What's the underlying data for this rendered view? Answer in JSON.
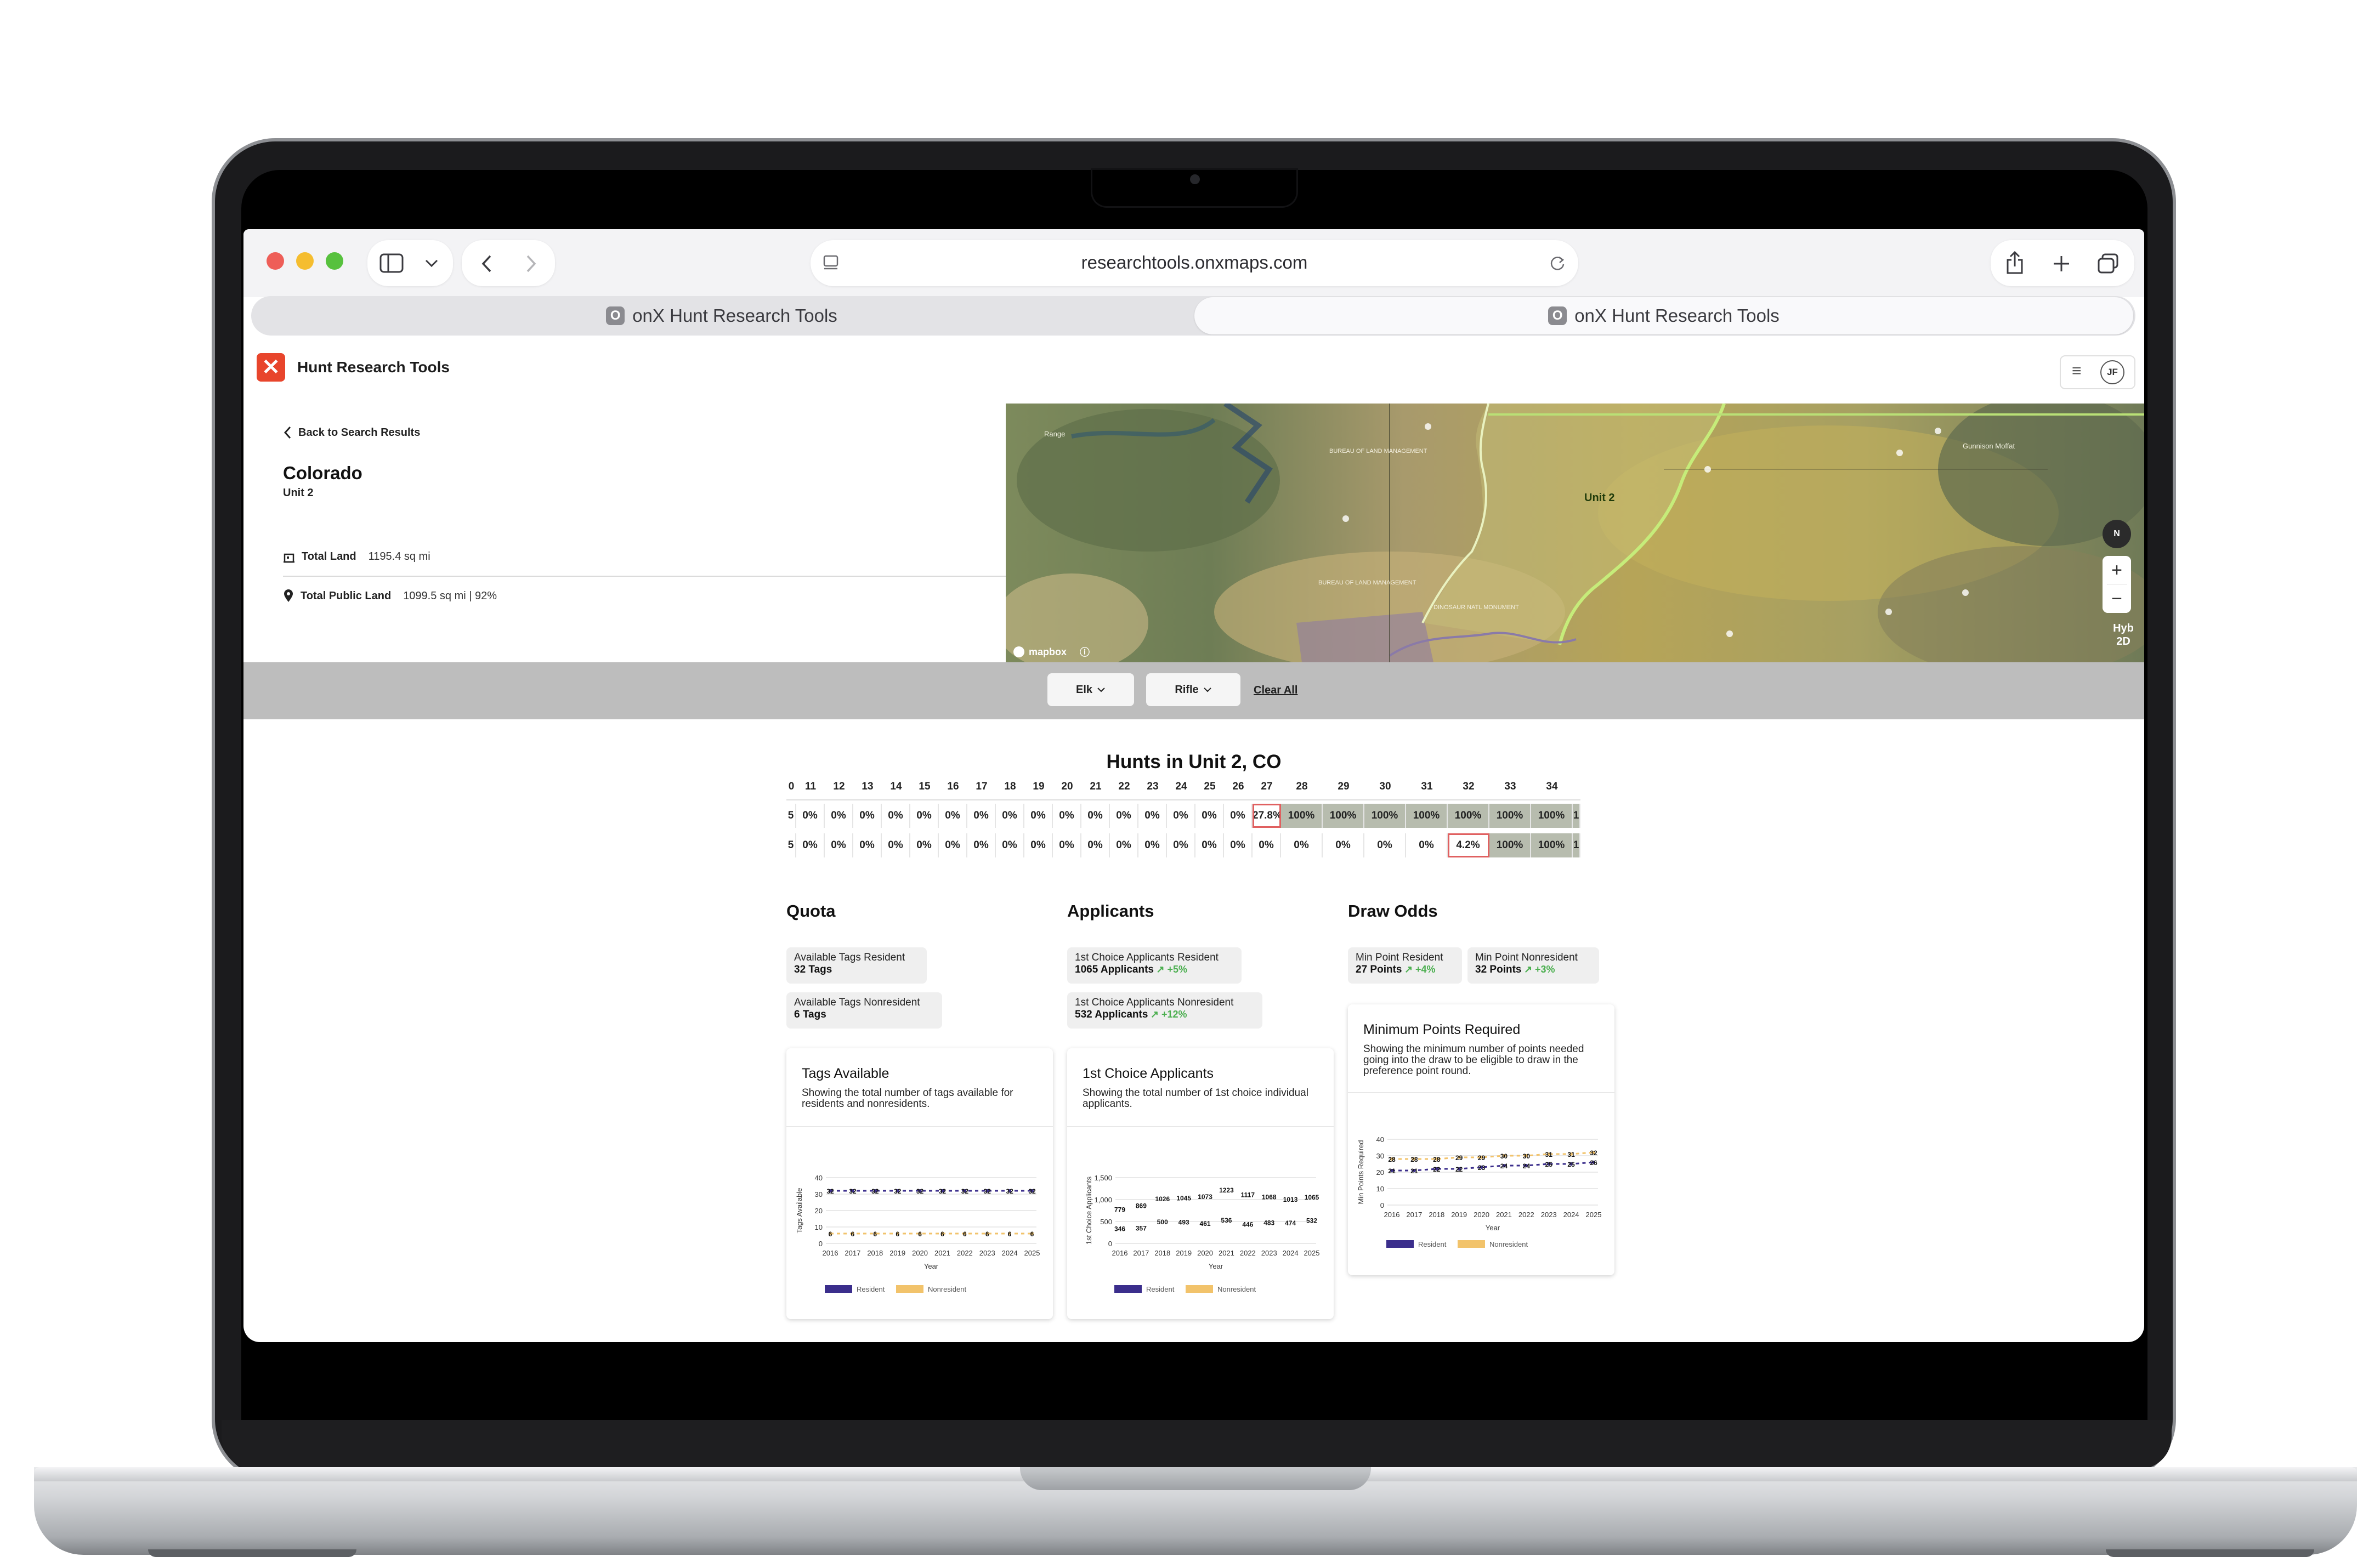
{
  "browser": {
    "url": "researchtools.onxmaps.com",
    "tabs": [
      {
        "label": "onX Hunt Research Tools",
        "favicon": "O"
      },
      {
        "label": "onX Hunt Research Tools",
        "favicon": "O"
      }
    ]
  },
  "app": {
    "logo_glyph": "✕",
    "title": "Hunt Research Tools",
    "user_initials": "JF",
    "menu_icon": "≡"
  },
  "info": {
    "back_label": "Back to Search Results",
    "state": "Colorado",
    "unit": "Unit 2",
    "total_land_label": "Total Land",
    "total_land_value": "1195.4 sq mi",
    "public_land_label": "Total Public Land",
    "public_land_value": "1099.5 sq mi | 92%"
  },
  "map": {
    "unit_label": "Unit 2",
    "labels": [
      "BUREAU OF LAND MANAGEMENT",
      "BUREAU OF LAND MANAGEMENT",
      "DINOSAUR NATL MONUMENT",
      "Gunnison Moffat",
      "Range"
    ],
    "compass": "N",
    "zoom_in": "+",
    "zoom_out": "−",
    "layer_label": "Hyb",
    "view_label": "2D",
    "attribution": "mapbox",
    "info_icon": "ⓘ"
  },
  "filters": {
    "species": "Elk",
    "weapon": "Rifle",
    "clear": "Clear All"
  },
  "hunts": {
    "title": "Hunts in Unit 2, CO",
    "columns": [
      "0",
      "11",
      "12",
      "13",
      "14",
      "15",
      "16",
      "17",
      "18",
      "19",
      "20",
      "21",
      "22",
      "23",
      "24",
      "25",
      "26",
      "27",
      "28",
      "29",
      "30",
      "31",
      "32",
      "33",
      "34",
      ""
    ],
    "rows": [
      [
        "5",
        "0%",
        "0%",
        "0%",
        "0%",
        "0%",
        "0%",
        "0%",
        "0%",
        "0%",
        "0%",
        "0%",
        "0%",
        "0%",
        "0%",
        "0%",
        "0%",
        "27.8%",
        "100%",
        "100%",
        "100%",
        "100%",
        "100%",
        "100%",
        "100%",
        "1"
      ],
      [
        "5",
        "0%",
        "0%",
        "0%",
        "0%",
        "0%",
        "0%",
        "0%",
        "0%",
        "0%",
        "0%",
        "0%",
        "0%",
        "0%",
        "0%",
        "0%",
        "0%",
        "0%",
        "0%",
        "0%",
        "0%",
        "0%",
        "4.2%",
        "100%",
        "100%",
        "1"
      ]
    ]
  },
  "quota": {
    "title": "Quota",
    "stats": [
      {
        "label": "Available Tags Resident",
        "value": "32 Tags"
      },
      {
        "label": "Available Tags Nonresident",
        "value": "6 Tags"
      }
    ],
    "card_title": "Tags Available",
    "card_desc": "Showing the total number of tags available for residents and nonresidents."
  },
  "applicants": {
    "title": "Applicants",
    "stats": [
      {
        "label": "1st Choice Applicants Resident",
        "value": "1065 Applicants",
        "delta": "↗ +5%"
      },
      {
        "label": "1st Choice Applicants Nonresident",
        "value": "532 Applicants",
        "delta": "↗ +12%"
      }
    ],
    "card_title": "1st Choice Applicants",
    "card_desc": "Showing the total number of 1st choice individual applicants."
  },
  "draw_odds": {
    "title": "Draw Odds",
    "stats": [
      {
        "label": "Min Point Resident",
        "value": "27 Points",
        "delta": "↗ +4%"
      },
      {
        "label": "Min Point Nonresident",
        "value": "32 Points",
        "delta": "↗ +3%"
      }
    ],
    "card_title": "Minimum Points Required",
    "card_desc": "Showing the minimum number of points needed going into the draw to be eligible to draw in the preference point round."
  },
  "legend": {
    "resident": "Resident",
    "nonresident": "Nonresident"
  },
  "colors": {
    "resident": "#3b2e8c",
    "nonresident": "#f2c36b",
    "accent": "#e8452c",
    "cell_full": "#b7bcae"
  },
  "chart_data": [
    {
      "type": "line",
      "x": [
        "2016",
        "2017",
        "2018",
        "2019",
        "2020",
        "2021",
        "2022",
        "2023",
        "2024",
        "2025"
      ],
      "xlabel": "Year",
      "ylabel": "Tags Available",
      "ylim": [
        0,
        40
      ],
      "yticks": [
        "0",
        "10",
        "20",
        "30",
        "40"
      ],
      "series": [
        {
          "name": "Resident",
          "values": [
            32,
            32,
            32,
            32,
            32,
            32,
            32,
            32,
            32,
            32
          ]
        },
        {
          "name": "Nonresident",
          "values": [
            6,
            6,
            6,
            6,
            6,
            6,
            6,
            6,
            6,
            6
          ]
        }
      ]
    },
    {
      "type": "bar",
      "x": [
        "2016",
        "2017",
        "2018",
        "2019",
        "2020",
        "2021",
        "2022",
        "2023",
        "2024",
        "2025"
      ],
      "xlabel": "Year",
      "ylabel": "1st Choice Applicants",
      "ylim": [
        0,
        1500
      ],
      "yticks": [
        "0",
        "500",
        "1,000",
        "1,500"
      ],
      "series": [
        {
          "name": "Resident",
          "values": [
            779,
            869,
            1026,
            1045,
            1073,
            1223,
            1117,
            1068,
            1013,
            1065
          ]
        },
        {
          "name": "Nonresident",
          "values": [
            346,
            357,
            500,
            493,
            461,
            536,
            446,
            483,
            474,
            532
          ]
        }
      ]
    },
    {
      "type": "line",
      "x": [
        "2016",
        "2017",
        "2018",
        "2019",
        "2020",
        "2021",
        "2022",
        "2023",
        "2024",
        "2025"
      ],
      "xlabel": "Year",
      "ylabel": "Min Points Required",
      "ylim": [
        0,
        40
      ],
      "yticks": [
        "0",
        "10",
        "20",
        "30",
        "40"
      ],
      "series": [
        {
          "name": "Resident",
          "values": [
            21,
            21,
            22,
            22,
            23,
            24,
            24,
            25,
            25,
            26,
            27
          ]
        },
        {
          "name": "Nonresident",
          "values": [
            28,
            28,
            28,
            29,
            29,
            30,
            30,
            31,
            31,
            32,
            32
          ]
        }
      ]
    }
  ]
}
